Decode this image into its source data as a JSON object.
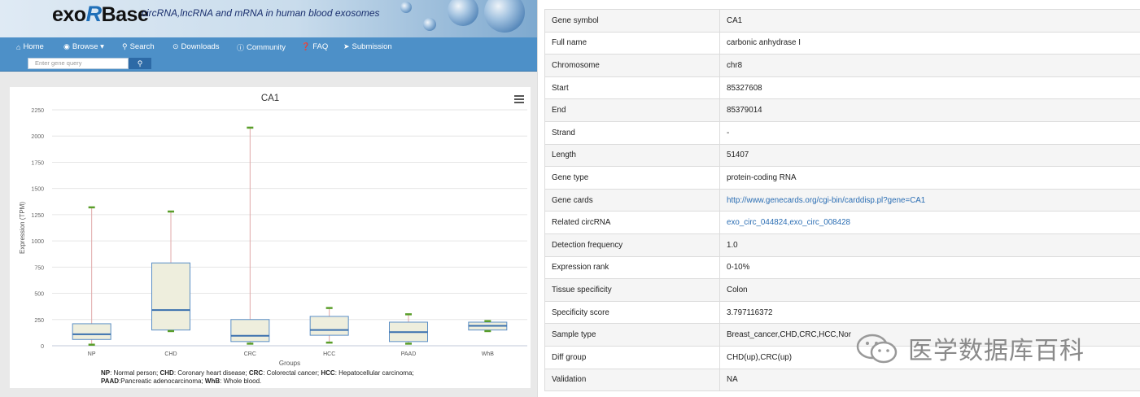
{
  "site": {
    "logo_prefix": "exo",
    "logo_r": "R",
    "logo_suffix": "Base",
    "tagline": "circRNA,lncRNA and mRNA in human blood exosomes"
  },
  "nav": {
    "items": [
      {
        "label": "Home",
        "icon": "home-icon"
      },
      {
        "label": "Browse ▾",
        "icon": "eye-icon"
      },
      {
        "label": "Search",
        "icon": "search-icon"
      },
      {
        "label": "Downloads",
        "icon": "download-icon"
      },
      {
        "label": "Community",
        "icon": "info-icon"
      },
      {
        "label": "FAQ",
        "icon": "question-icon"
      },
      {
        "label": "Submission",
        "icon": "send-icon"
      }
    ],
    "search_placeholder": "Enter gene query"
  },
  "chart_data": {
    "type": "boxplot",
    "title": "CA1",
    "xlabel": "Groups",
    "ylabel": "Expression (TPM)",
    "ylim": [
      0,
      2250
    ],
    "yticks": [
      0,
      250,
      500,
      750,
      1000,
      1250,
      1500,
      1750,
      2000,
      2250
    ],
    "categories": [
      "NP",
      "CHD",
      "CRC",
      "HCC",
      "PAAD",
      "WhB"
    ],
    "series": [
      {
        "boxes": [
          {
            "min": 10,
            "q1": 60,
            "median": 110,
            "q3": 210,
            "max": 1320
          },
          {
            "min": 140,
            "q1": 150,
            "median": 340,
            "q3": 790,
            "max": 1280
          },
          {
            "min": 20,
            "q1": 40,
            "median": 95,
            "q3": 250,
            "max": 2080
          },
          {
            "min": 30,
            "q1": 100,
            "median": 150,
            "q3": 280,
            "max": 360
          },
          {
            "min": 20,
            "q1": 40,
            "median": 130,
            "q3": 225,
            "max": 300
          },
          {
            "min": 140,
            "q1": 150,
            "median": 190,
            "q3": 225,
            "max": 235
          }
        ]
      }
    ],
    "colors": {
      "box_fill": "#eeeedd",
      "box_stroke": "#5b8fc6",
      "median": "#3a70ae",
      "whisker": "#e0a8a8",
      "extreme": "#5a9e2a"
    },
    "legend_lines": [
      [
        [
          "NP",
          true
        ],
        [
          ": Normal person; ",
          false
        ],
        [
          "CHD",
          true
        ],
        [
          ": Coronary heart disease; ",
          false
        ],
        [
          "CRC",
          true
        ],
        [
          ": Colorectal cancer; ",
          false
        ],
        [
          "HCC",
          true
        ],
        [
          ": Hepatocellular carcinoma;",
          false
        ]
      ],
      [
        [
          "PAAD",
          true
        ],
        [
          ":Pancreatic adenocarcinoma; ",
          false
        ],
        [
          "WhB",
          true
        ],
        [
          ": Whole blood.",
          false
        ]
      ]
    ]
  },
  "gene_info": {
    "rows": [
      {
        "key": "Gene symbol",
        "value": "CA1"
      },
      {
        "key": "Full name",
        "value": "carbonic anhydrase I"
      },
      {
        "key": "Chromosome",
        "value": "chr8"
      },
      {
        "key": "Start",
        "value": "85327608"
      },
      {
        "key": "End",
        "value": "85379014"
      },
      {
        "key": "Strand",
        "value": "-"
      },
      {
        "key": "Length",
        "value": "51407"
      },
      {
        "key": "Gene type",
        "value": "protein-coding RNA"
      },
      {
        "key": "Gene cards",
        "value": "http://www.genecards.org/cgi-bin/carddisp.pl?gene=CA1",
        "link": true
      },
      {
        "key": "Related circRNA",
        "value": "exo_circ_044824,exo_circ_008428",
        "link": true
      },
      {
        "key": "Detection frequency",
        "value": "1.0"
      },
      {
        "key": "Expression rank",
        "value": "0-10%"
      },
      {
        "key": "Tissue specificity",
        "value": "Colon"
      },
      {
        "key": "Specificity score",
        "value": "3.797116372"
      },
      {
        "key": "Sample type",
        "value": "Breast_cancer,CHD,CRC,HCC,Nor"
      },
      {
        "key": "Diff group",
        "value": "CHD(up),CRC(up)"
      },
      {
        "key": "Validation",
        "value": "NA"
      }
    ]
  },
  "watermark": {
    "text": "医学数据库百科"
  }
}
